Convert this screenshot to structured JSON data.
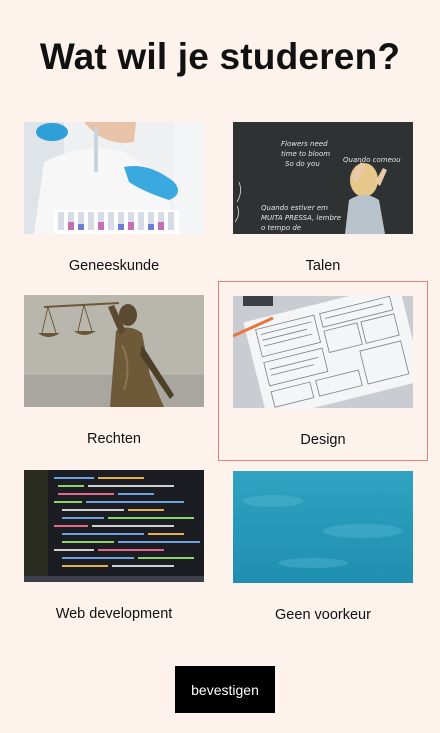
{
  "page": {
    "title": "Wat wil je studeren?"
  },
  "options": [
    {
      "label": "Geneeskunde",
      "selected": false
    },
    {
      "label": "Talen",
      "selected": false
    },
    {
      "label": "Rechten",
      "selected": false
    },
    {
      "label": "Design",
      "selected": true
    },
    {
      "label": "Web development",
      "selected": false
    },
    {
      "label": "Geen voorkeur",
      "selected": false
    }
  ],
  "chalkboard_text": {
    "line1": "Flowers need",
    "line2": "time to bloom",
    "line3": "So do you",
    "line4": "Quando comeou",
    "line5": "Quando estiver em",
    "line6": "MUITA PRESSA, lembre",
    "line7": "o tempo de"
  },
  "confirm_button": {
    "label": "bevestigen"
  },
  "colors": {
    "background": "#fdf3ec",
    "selected_outline": "#e2837b",
    "button_bg": "#000000"
  }
}
